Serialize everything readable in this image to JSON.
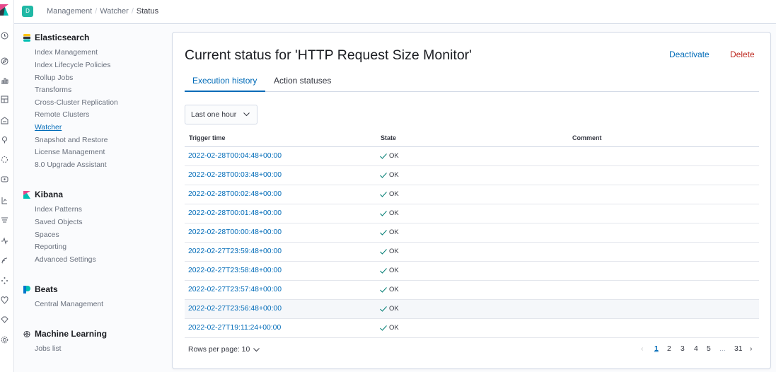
{
  "header": {
    "space_initial": "D",
    "breadcrumbs": [
      "Management",
      "Watcher",
      "Status"
    ]
  },
  "sidebar": {
    "sections": [
      {
        "title": "Elasticsearch",
        "icon": "elasticsearch-icon",
        "items": [
          "Index Management",
          "Index Lifecycle Policies",
          "Rollup Jobs",
          "Transforms",
          "Cross-Cluster Replication",
          "Remote Clusters",
          "Watcher",
          "Snapshot and Restore",
          "License Management",
          "8.0 Upgrade Assistant"
        ]
      },
      {
        "title": "Kibana",
        "icon": "kibana-icon",
        "items": [
          "Index Patterns",
          "Saved Objects",
          "Spaces",
          "Reporting",
          "Advanced Settings"
        ]
      },
      {
        "title": "Beats",
        "icon": "beats-icon",
        "items": [
          "Central Management"
        ]
      },
      {
        "title": "Machine Learning",
        "icon": "machine-learning-icon",
        "items": [
          "Jobs list"
        ]
      }
    ],
    "active_item": "Watcher"
  },
  "page": {
    "title": "Current status for 'HTTP Request Size Monitor'",
    "deactivate_label": "Deactivate",
    "delete_label": "Delete",
    "tabs": [
      "Execution history",
      "Action statuses"
    ],
    "active_tab": "Execution history",
    "time_filter": "Last one hour"
  },
  "table": {
    "columns": [
      "Trigger time",
      "State",
      "Comment"
    ],
    "rows": [
      {
        "trigger_time": "2022-02-28T00:04:48+00:00",
        "state": "OK",
        "comment": ""
      },
      {
        "trigger_time": "2022-02-28T00:03:48+00:00",
        "state": "OK",
        "comment": ""
      },
      {
        "trigger_time": "2022-02-28T00:02:48+00:00",
        "state": "OK",
        "comment": ""
      },
      {
        "trigger_time": "2022-02-28T00:01:48+00:00",
        "state": "OK",
        "comment": ""
      },
      {
        "trigger_time": "2022-02-28T00:00:48+00:00",
        "state": "OK",
        "comment": ""
      },
      {
        "trigger_time": "2022-02-27T23:59:48+00:00",
        "state": "OK",
        "comment": ""
      },
      {
        "trigger_time": "2022-02-27T23:58:48+00:00",
        "state": "OK",
        "comment": ""
      },
      {
        "trigger_time": "2022-02-27T23:57:48+00:00",
        "state": "OK",
        "comment": ""
      },
      {
        "trigger_time": "2022-02-27T23:56:48+00:00",
        "state": "OK",
        "comment": ""
      },
      {
        "trigger_time": "2022-02-27T19:11:24+00:00",
        "state": "OK",
        "comment": ""
      }
    ],
    "rows_per_page_label": "Rows per page: 10"
  },
  "pagination": {
    "current_page": "1",
    "pages": [
      "1",
      "2",
      "3",
      "4",
      "5"
    ],
    "ellipsis": "...",
    "last_page": "31"
  },
  "colors": {
    "primary": "#006bb8",
    "danger": "#bd271e",
    "success": "#017d73",
    "space_badge": "#20b8a5"
  }
}
